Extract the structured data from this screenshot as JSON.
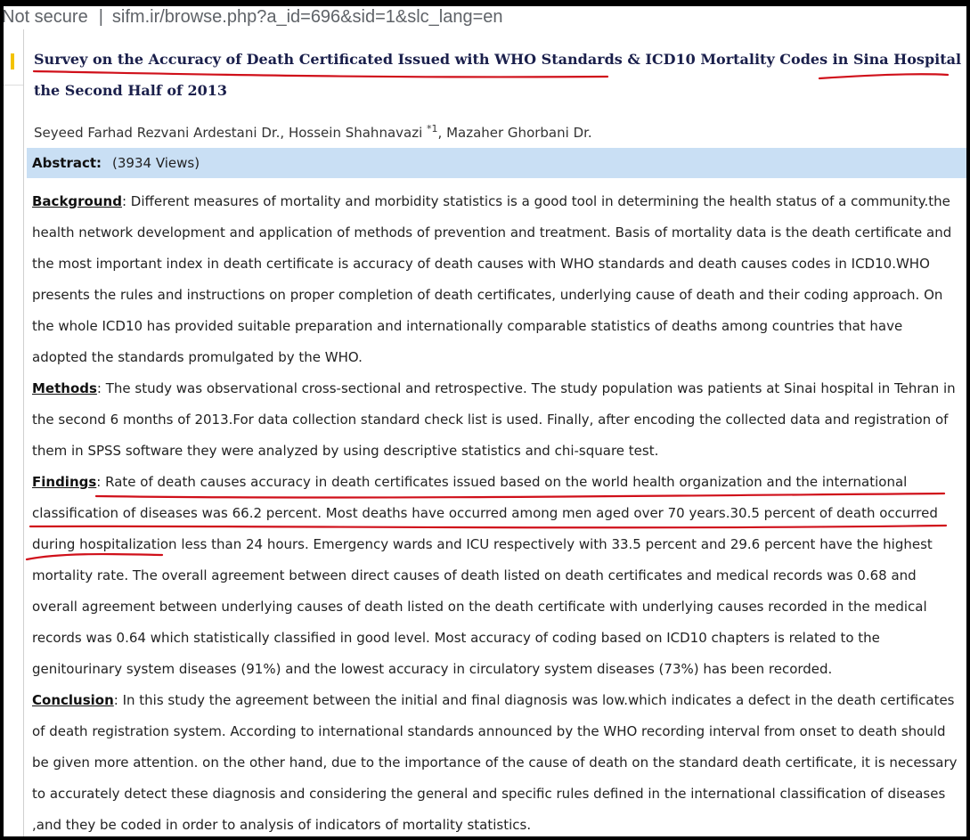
{
  "browser": {
    "security": "Not secure",
    "url": "sifm.ir/browse.php?a_id=696&sid=1&slc_lang=en"
  },
  "article": {
    "title_line1": "Survey on the Accuracy of Death Certificated Issued with WHO Standards & ICD10 Mortality Codes in Sina Hospital in Tehran in",
    "title_line2": "the Second Half of 2013",
    "authors_before": "Seyeed Farhad Rezvani Ardestani Dr., Hossein Shahnavazi ",
    "authors_sup": "*1",
    "authors_after": ", Mazaher Ghorbani Dr.",
    "abstract_label": "Abstract:",
    "views": "(3934 Views)",
    "sections": {
      "background_heading": "Background",
      "background_text": ": Different measures of mortality and morbidity statistics is a good tool in determining the health status of a community.the health network development and application of methods of prevention and treatment. Basis of mortality data is the death certificate and the most important index in death certificate is accuracy of death causes with WHO standards and death causes codes in ICD10.WHO presents the rules and instructions on proper completion of death certificates, underlying cause of death and their coding approach. On the whole ICD10 has provided suitable preparation and internationally comparable statistics of deaths among countries that have adopted the standards promulgated by the WHO.",
      "methods_heading": "Methods",
      "methods_text": ": The study was observational cross-sectional and retrospective. The study population was patients at Sinai hospital in Tehran in the second 6 months of 2013.For data collection standard check list is used. Finally, after encoding the collected data and registration of them in SPSS software they were analyzed by using descriptive statistics and chi-square test.",
      "findings_heading": "Findings",
      "findings_text": ": Rate of death causes accuracy in death certificates issued based on the world health organization and the international classification of diseases was 66.2 percent. Most deaths have occurred among men aged over 70 years.30.5 percent of death occurred during hospitalization less than 24 hours. Emergency wards and ICU respectively with 33.5 percent and 29.6 percent have the highest mortality rate. The overall agreement between direct causes of death listed on death certificates and medical records was 0.68 and overall agreement between underlying causes of death listed on the death certificate with underlying causes recorded in the medical records was 0.64 which statistically classified in good level. Most accuracy of coding based on ICD10 chapters is related to the genitourinary system diseases (91%) and the lowest accuracy in circulatory system diseases (73%) has been recorded.",
      "conclusion_heading": "Conclusion",
      "conclusion_text": ": In this study the agreement between the initial and final diagnosis was low.which indicates a defect in the death certificates of death registration system. According to international standards announced by the WHO recording interval from onset to death should be given more attention. on the other hand, due to the importance of the cause of death on the standard death certificate, it is necessary to accurately detect these diagnosis and considering the general and specific rules defined in the international classification of diseases ,and  they be coded in order to analysis of indicators of mortality statistics."
    }
  },
  "colors": {
    "abstract_bar": "#c9dff4",
    "title": "#1a1f4b",
    "annotation": "#d0101a"
  }
}
